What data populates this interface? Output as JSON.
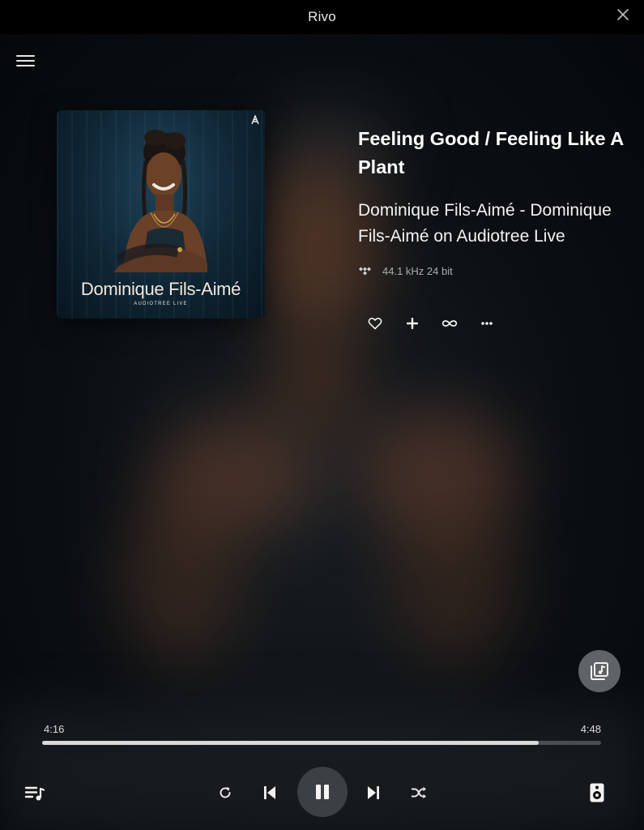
{
  "window": {
    "title": "Rivo"
  },
  "album_art": {
    "artist_name": "Dominique Fils-Aimé",
    "subtitle": "AUDIOTREE LIVE"
  },
  "track": {
    "title": "Feeling Good / Feeling Like A Plant",
    "artist_line": "Dominique Fils-Aimé - Dominique Fils-Aimé on Audiotree Live",
    "quality": "44.1 kHz 24 bit",
    "source_icon": "tidal-icon"
  },
  "actions": {
    "items": [
      "heart-icon",
      "plus-icon",
      "infinity-icon",
      "more-icon"
    ]
  },
  "playback": {
    "elapsed": "4:16",
    "total": "4:48",
    "progress_fraction": 0.889,
    "state": "playing"
  },
  "colors": {
    "background": "#06090c",
    "titlebar": "#000000",
    "play_button": "#3c4044",
    "progress_fill": "#d9d9d9",
    "progress_track": "#4a4e52"
  }
}
